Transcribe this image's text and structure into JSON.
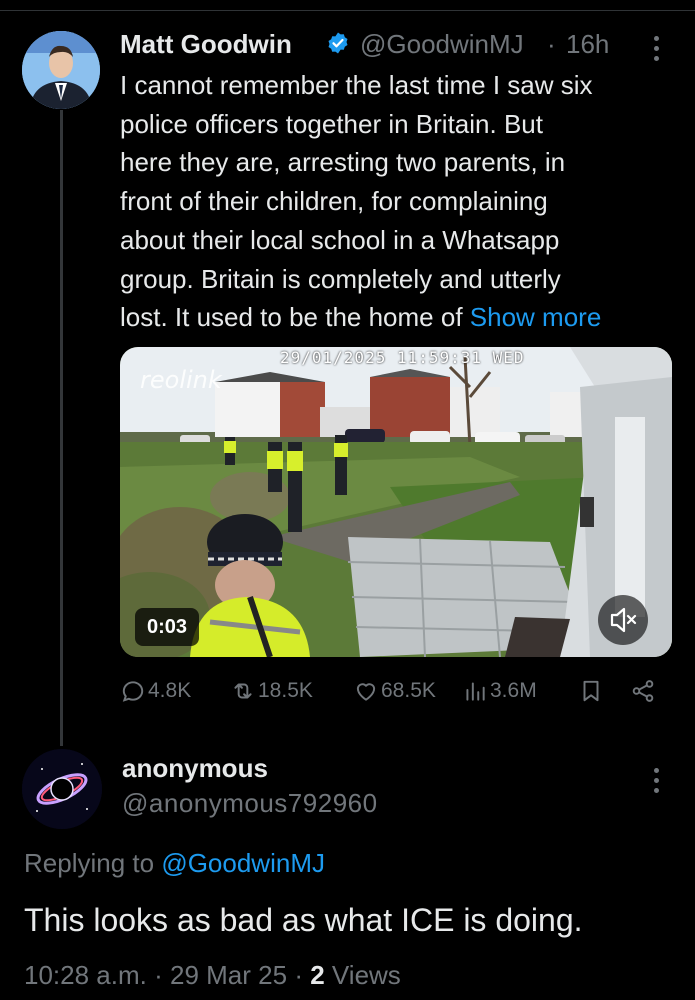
{
  "tweet": {
    "author_name": "Matt Goodwin",
    "handle": "@GoodwinMJ",
    "separator": "·",
    "time_ago": "16h",
    "text_lines": [
      "I cannot remember the last time I saw six",
      "police officers together in Britain. But",
      "here they are, arresting two parents, in",
      "front of their children, for complaining",
      "about their local school in a Whatsapp",
      "group. Britain is completely and utterly",
      "lost. It used to be the home of "
    ],
    "show_more": "Show more",
    "video": {
      "duration": "0:03",
      "overlay_timestamp": "29/01/2025 11:59:31 WED",
      "overlay_brand": "reolink"
    },
    "metrics": {
      "replies": "4.8K",
      "reposts": "18.5K",
      "likes": "68.5K",
      "views": "3.6M"
    }
  },
  "reply": {
    "author_name": "anonymous",
    "handle": "@anonymous792960",
    "replying_prefix": "Replying to ",
    "replying_to": "@GoodwinMJ",
    "text": "This looks as bad as what ICE is doing.",
    "time": "10:28 a.m.",
    "separator": "·",
    "date": "29 Mar 25",
    "views_count": "2",
    "views_label": "Views"
  },
  "colors": {
    "background": "#000000",
    "accent": "#1d9bf0",
    "secondary_text": "#71767b",
    "primary_text": "#e7e9ea"
  }
}
